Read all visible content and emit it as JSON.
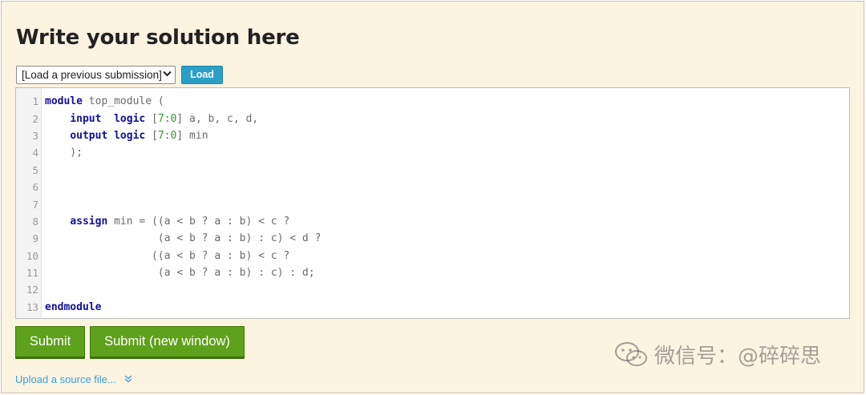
{
  "page": {
    "title": "Write your solution here"
  },
  "load": {
    "select_value": "[Load a previous submission]",
    "button_label": "Load"
  },
  "editor": {
    "lines": [
      {
        "n": "1",
        "segments": [
          {
            "t": "module",
            "c": "kw"
          },
          {
            "t": " top_module (",
            "c": ""
          }
        ]
      },
      {
        "n": "2",
        "segments": [
          {
            "t": "    ",
            "c": ""
          },
          {
            "t": "input",
            "c": "kw"
          },
          {
            "t": "  ",
            "c": ""
          },
          {
            "t": "logic",
            "c": "kw"
          },
          {
            "t": " [",
            "c": ""
          },
          {
            "t": "7:0",
            "c": "nm"
          },
          {
            "t": "] a, b, c, d,",
            "c": ""
          }
        ]
      },
      {
        "n": "3",
        "segments": [
          {
            "t": "    ",
            "c": ""
          },
          {
            "t": "output",
            "c": "kw"
          },
          {
            "t": " ",
            "c": ""
          },
          {
            "t": "logic",
            "c": "kw"
          },
          {
            "t": " [",
            "c": ""
          },
          {
            "t": "7:0",
            "c": "nm"
          },
          {
            "t": "] min",
            "c": ""
          }
        ]
      },
      {
        "n": "4",
        "segments": [
          {
            "t": "    );",
            "c": ""
          }
        ]
      },
      {
        "n": "5",
        "segments": []
      },
      {
        "n": "6",
        "segments": []
      },
      {
        "n": "7",
        "segments": []
      },
      {
        "n": "8",
        "segments": [
          {
            "t": "    ",
            "c": ""
          },
          {
            "t": "assign",
            "c": "kw"
          },
          {
            "t": " min = ((a < b ? a : b) < c ?",
            "c": ""
          }
        ]
      },
      {
        "n": "9",
        "segments": [
          {
            "t": "                  (a < b ? a : b) : c) < d ?",
            "c": ""
          }
        ]
      },
      {
        "n": "10",
        "segments": [
          {
            "t": "                 ((a < b ? a : b) < c ?",
            "c": ""
          }
        ]
      },
      {
        "n": "11",
        "segments": [
          {
            "t": "                  (a < b ? a : b) : c) : d;",
            "c": ""
          }
        ]
      },
      {
        "n": "12",
        "segments": []
      },
      {
        "n": "13",
        "segments": [
          {
            "t": "endmodule",
            "c": "kw"
          }
        ]
      }
    ]
  },
  "actions": {
    "submit_label": "Submit",
    "submit_new_label": "Submit (new window)",
    "upload_label": "Upload a source file...",
    "upload_icon": "double-chevron-down-icon"
  },
  "watermark": {
    "text": "微信号：@碎碎思"
  },
  "colors": {
    "panel_bg": "#fdf3e1",
    "load_button": "#2b9fc8",
    "submit_green": "#5ea11a",
    "keyword": "#10109a",
    "number": "#2f9a2f",
    "link": "#3aa0d8"
  }
}
